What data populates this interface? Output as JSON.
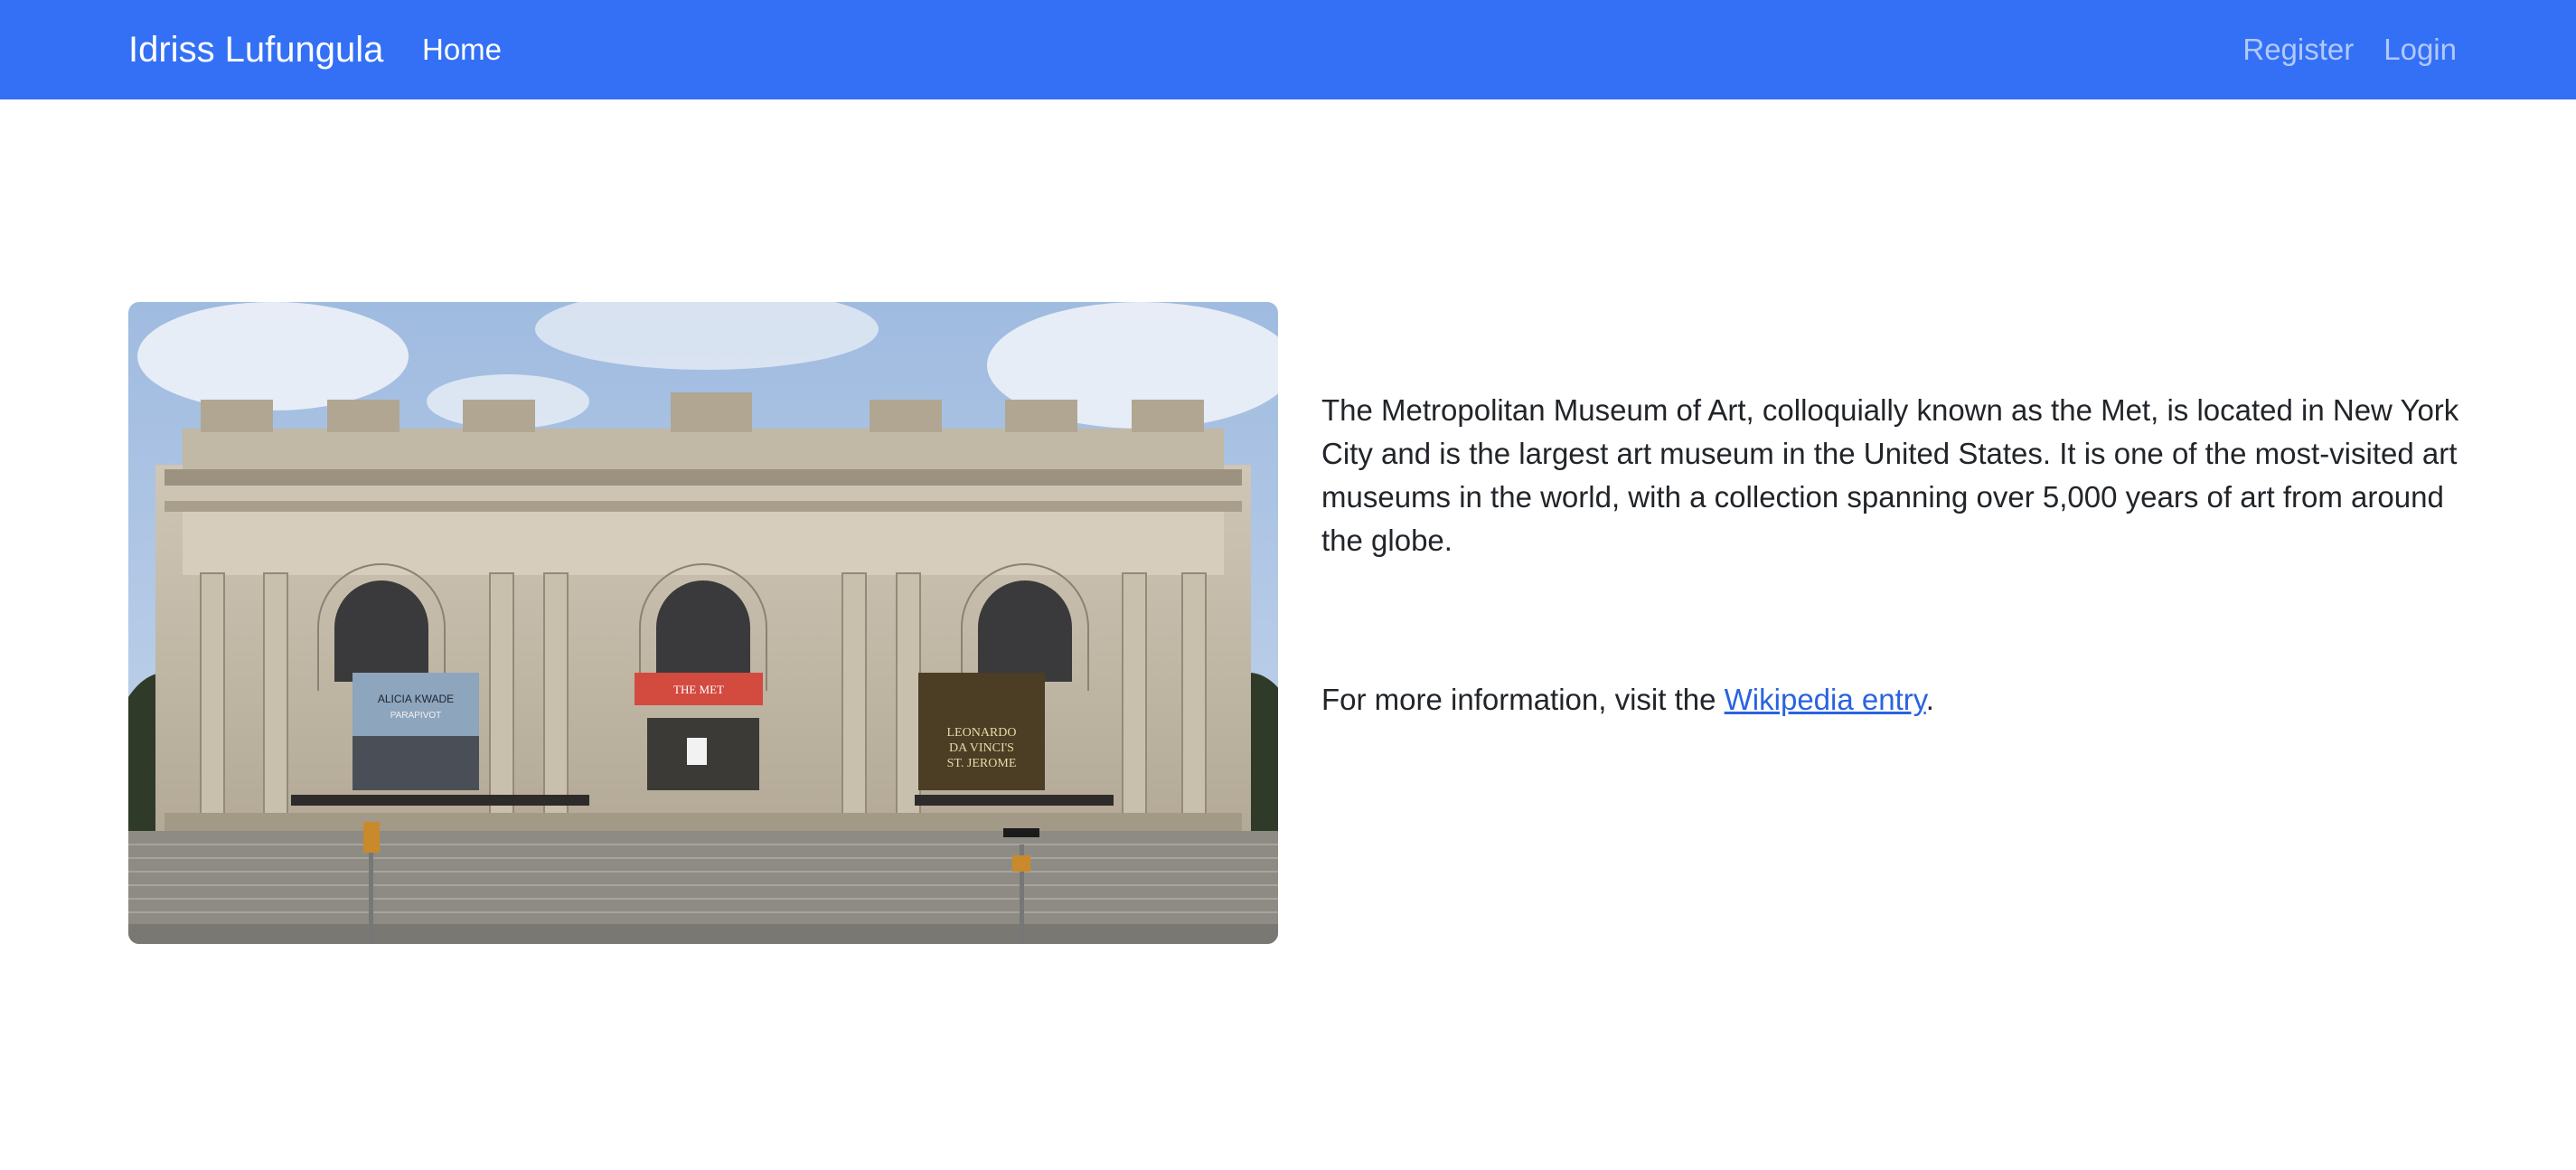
{
  "navbar": {
    "brand": "Idriss Lufungula",
    "home_label": "Home",
    "register_label": "Register",
    "login_label": "Login",
    "background_color": "#3370f5"
  },
  "hero": {
    "image_subject": "Metropolitan Museum of Art facade",
    "banner_left_text": "ALICIA KWADE",
    "banner_left_sub": "PARAPIVOT",
    "banner_center_text": "THE MET",
    "banner_right_line1": "LEONARDO",
    "banner_right_line2": "DA VINCI'S",
    "banner_right_line3": "ST. JEROME"
  },
  "content": {
    "description": "The Metropolitan Museum of Art, colloquially known as the Met, is located in New York City and is the largest art museum in the United States. It is one of the most-visited art museums in the world, with a collection spanning over 5,000 years of art from around the globe.",
    "more_info_prefix": "For more information, visit the ",
    "more_info_link": "Wikipedia entry",
    "more_info_suffix": ".",
    "link_color": "#2a63e0"
  }
}
